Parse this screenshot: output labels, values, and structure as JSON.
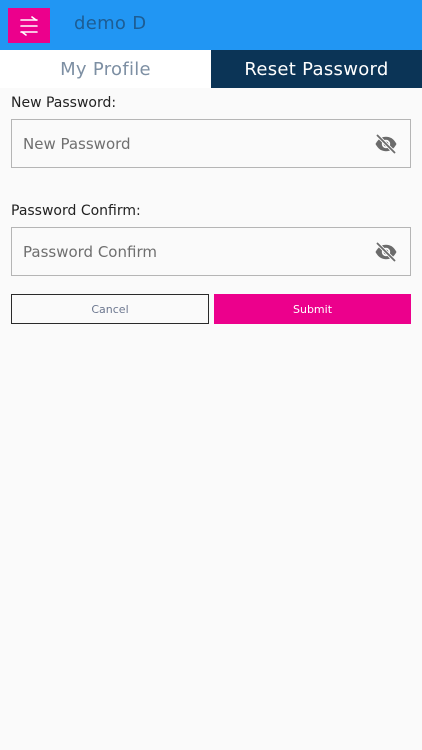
{
  "header": {
    "title": "demo D",
    "menu_icon": "menu-icon"
  },
  "tabs": [
    {
      "label": "My Profile",
      "active": false
    },
    {
      "label": "Reset Password",
      "active": true
    }
  ],
  "form": {
    "new_password": {
      "label": "New Password:",
      "placeholder": "New Password",
      "value": "",
      "icon": "eye-off-icon"
    },
    "password_confirm": {
      "label": "Password Confirm:",
      "placeholder": "Password Confirm",
      "value": "",
      "icon": "eye-off-icon"
    }
  },
  "buttons": {
    "cancel_label": "Cancel",
    "submit_label": "Submit"
  },
  "colors": {
    "header": "#2196f3",
    "accent": "#ec008c",
    "active_tab": "#0b3456"
  }
}
